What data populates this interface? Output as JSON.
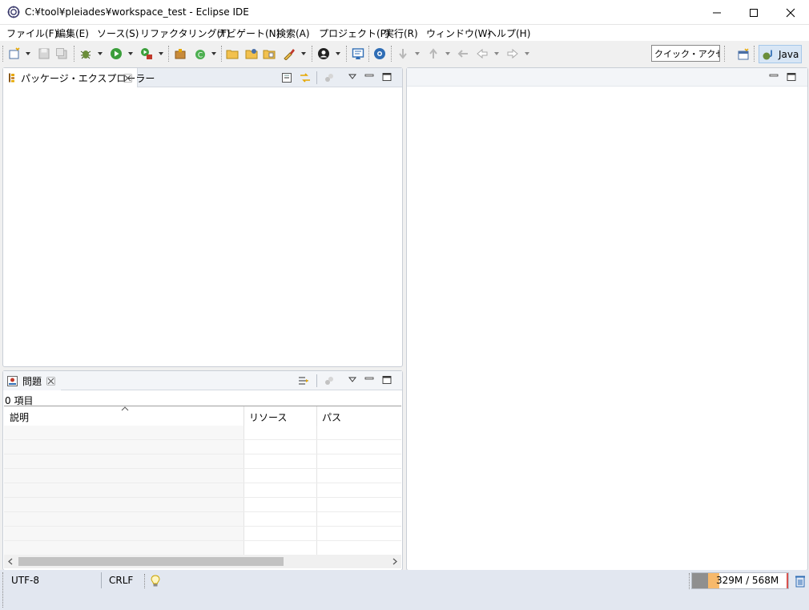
{
  "window": {
    "title": "C:¥tool¥pleiades¥workspace_test - Eclipse IDE"
  },
  "menu": [
    {
      "label": "ファイル(F)"
    },
    {
      "label": "編集(E)"
    },
    {
      "label": "ソース(S)"
    },
    {
      "label": "リファクタリング(T)"
    },
    {
      "label": "ナビゲート(N)"
    },
    {
      "label": "検索(A)"
    },
    {
      "label": "プロジェクト(P)"
    },
    {
      "label": "実行(R)"
    },
    {
      "label": "ウィンドウ(W)"
    },
    {
      "label": "ヘルプ(H)"
    }
  ],
  "toolbar": {
    "quick_access": "クイック・アクセス",
    "perspective": "Java"
  },
  "package_explorer": {
    "tab_label": "パッケージ・エクスプローラー"
  },
  "problems": {
    "tab_label": "問題",
    "count_label": "0 項目",
    "columns": [
      "説明",
      "リソース",
      "パス"
    ]
  },
  "status": {
    "encoding": "UTF-8",
    "line_delimiter": "CRLF",
    "heap": "329M / 568M",
    "heap_fraction": 0.58
  },
  "colors": {
    "accent": "#2f6db5",
    "heap_used": "#f7b96b",
    "run_green": "#3a9e3a"
  }
}
